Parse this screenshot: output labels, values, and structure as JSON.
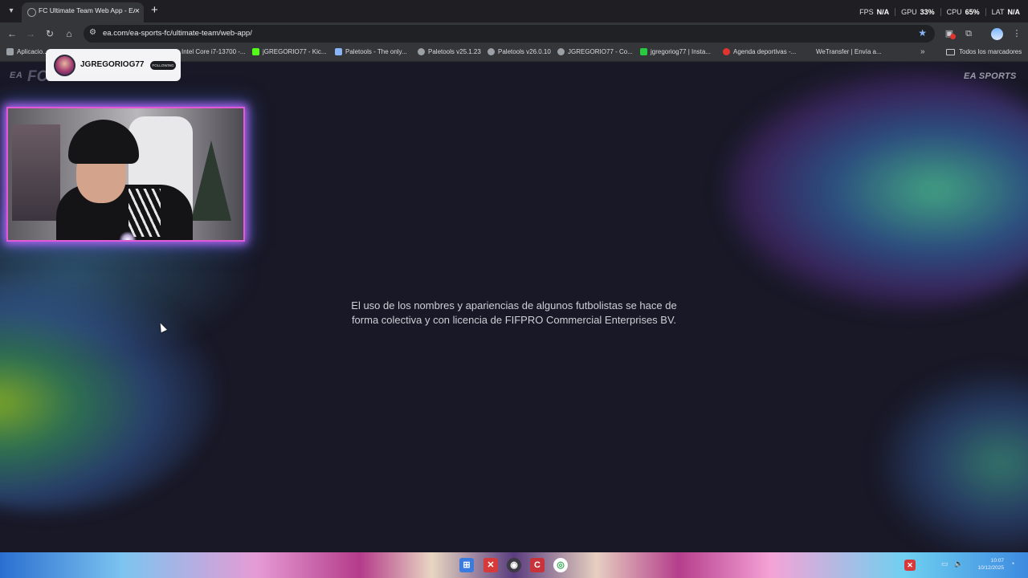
{
  "browser": {
    "tab_title": "FC Ultimate Team Web App - EA",
    "new_tab": "+",
    "tab_close": "×",
    "url": "ea.com/ea-sports-fc/ultimate-team/web-app/"
  },
  "overlay_stats": [
    {
      "label": "FPS",
      "value": "N/A"
    },
    {
      "label": "GPU",
      "value": "33%"
    },
    {
      "label": "CPU",
      "value": "65%"
    },
    {
      "label": "LAT",
      "value": "N/A"
    }
  ],
  "bookmarks": [
    {
      "label": "Aplicacio...",
      "color": "#5f6368"
    },
    {
      "label": "Intel Core i7-13700 -...",
      "color": "#5f6368"
    },
    {
      "label": "jGREGORIO77 - Kic...",
      "color": "#53fc18"
    },
    {
      "label": "Paletools - The only...",
      "color": "#8ab4f8"
    },
    {
      "label": "Paletools v25.1.23",
      "color": "#9aa0a6"
    },
    {
      "label": "Paletools v26.0.10",
      "color": "#9aa0a6"
    },
    {
      "label": "JGREGORIO77 - Co...",
      "color": "#9aa0a6"
    },
    {
      "label": "jgregoriog77 | Insta...",
      "color": "#27c93f"
    },
    {
      "label": "Agenda deportivas -...",
      "color": "#e2342f"
    },
    {
      "label": "WeTransfer | Envía a...",
      "color": "#5f6368"
    }
  ],
  "bookmarks_folder": "Todos los marcadores",
  "page": {
    "logo_small": "EA",
    "logo_game": "FC26",
    "ea_sports": "EA SPORTS",
    "legal_text": "El uso de los nombres y apariencias de algunos futbolistas se hace de forma colectiva y con licencia de FIFPRO Commercial Enterprises BV."
  },
  "stream": {
    "follow_name": "JGREGORIOG77",
    "follow_status": "FOLLOWING"
  },
  "taskbar": {
    "time": "10:07",
    "date": "10/12/2025"
  }
}
